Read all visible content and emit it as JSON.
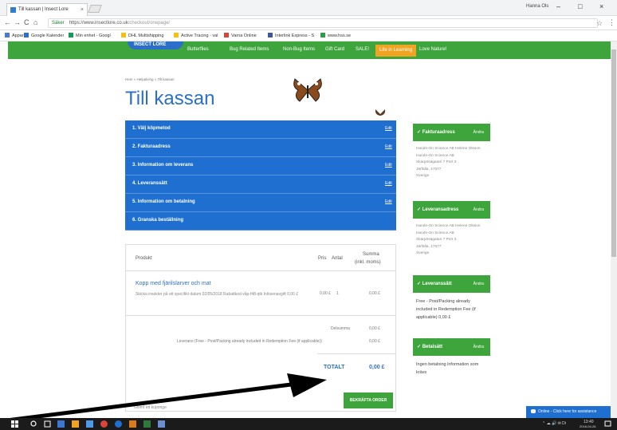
{
  "browser": {
    "tab_title": "Till kassan | Insect Lore",
    "tab_close": "×",
    "profile_name": "Hanna Ols",
    "win_controls": [
      "–",
      "□",
      "×"
    ],
    "nav_icons": [
      "←",
      "→",
      "C",
      "⌂"
    ],
    "url_secure": "Säker",
    "url_base": "https://www.insectlore.co.uk",
    "url_path": "/checkout/onepage/",
    "bookmarks": [
      {
        "label": "Appar",
        "color": "#4a7bd0"
      },
      {
        "label": "Google Kalender",
        "color": "#2f6fcf"
      },
      {
        "label": "Min enhet - Googl",
        "color": "#0f9d58"
      },
      {
        "label": "DHL Multishipping",
        "color": "#f4c20d"
      },
      {
        "label": "Active Tracing - val",
        "color": "#f4c20d"
      },
      {
        "label": "Varna Online",
        "color": "#db4437"
      },
      {
        "label": "Interlink Express - S",
        "color": "#3b5998"
      },
      {
        "label": "www.hss.se",
        "color": "#2e9e44"
      }
    ]
  },
  "site": {
    "logo": "INSECT LORE",
    "nav": [
      {
        "label": "Butterflies",
        "active": false
      },
      {
        "label": "Bug Related Items",
        "active": false
      },
      {
        "label": "Non-Bug Items",
        "active": false
      },
      {
        "label": "Gift Card",
        "active": false
      },
      {
        "label": "SALE!",
        "active": false
      },
      {
        "label": "Life in Learning",
        "active": true
      },
      {
        "label": "Love Nature!",
        "active": false
      }
    ],
    "breadcrumb": "Hem  »  Helpalving  »  Till kassan",
    "page_title": "Till kassan",
    "steps": [
      {
        "label": "1. Välj köpmetod",
        "edit": "Edit"
      },
      {
        "label": "2. Fakturaadress",
        "edit": "Edit"
      },
      {
        "label": "3. Information om leverans",
        "edit": "Edit"
      },
      {
        "label": "4. Leveranssätt",
        "edit": "Edit"
      },
      {
        "label": "5. Information om betalning",
        "edit": "Edit"
      },
      {
        "label": "6. Granska beställning",
        "edit": ""
      }
    ],
    "review": {
      "col_product": "Produkt",
      "col_price": "Pris",
      "col_qty": "Antal",
      "col_sum_1": "Summa",
      "col_sum_2": "(inkl. moms)",
      "product_name": "Kopp med fjärilslarver och mat",
      "product_desc": "Skicka insekter på ett specifikt datum 02/05/2018 Rabattkod våp-f48-qtk Inlösenavgift 0,00 £",
      "price": "0,00 £",
      "qty": "1",
      "line_sum": "0,00 £",
      "subtotal_label": "Delsumma",
      "subtotal_value": "0,00 £",
      "shipping_label": "Leverans (Free - Post/Packing already included in Redemption Fee (if applicable))",
      "shipping_value": "0,00 £",
      "total_label": "TOTALT",
      "total_value": "0,00 £",
      "confirm_button": "BEKRÄFTA ORDER",
      "forgot_link": "Glömt ett kuponge"
    },
    "sidebar": [
      {
        "title": "✓ Fakturaadress",
        "edit": "Ändra",
        "lines": [
          "Hands-On Science AB Helene Olsson",
          "Hands-On Science AB",
          "Skarpösägatan 7 Port 3",
          "Järfälla, 17677",
          "Sverige"
        ]
      },
      {
        "title": "✓ Leveransadress",
        "edit": "Ändra",
        "lines": [
          "Hands-On Science AB Helene Olsson",
          "Hands-On Science AB",
          "Skarpösägatan 7 Port 3",
          "Järfälla, 17677",
          "Sverige"
        ]
      },
      {
        "title": "✓ Leveranssätt",
        "edit": "Ändra",
        "lines": [
          "Free - Post/Packing already",
          "included in Redemption Fee (if",
          "applicable) 0,00 £"
        ]
      },
      {
        "title": "✓ Betalsätt",
        "edit": "Ändra",
        "lines": [
          "Ingen betalning information som",
          "krävs"
        ]
      }
    ],
    "chat_label": "Online - Click here for assistance"
  },
  "taskbar": {
    "tray_text": "⌃ ☁ 🔊 ✉ Di",
    "time": "13:40",
    "date": "2018-04-26"
  },
  "colors": {
    "green": "#3ea53c",
    "blue": "#1e6fd0",
    "title_blue": "#2b6fc8",
    "orange": "#f0a422"
  }
}
